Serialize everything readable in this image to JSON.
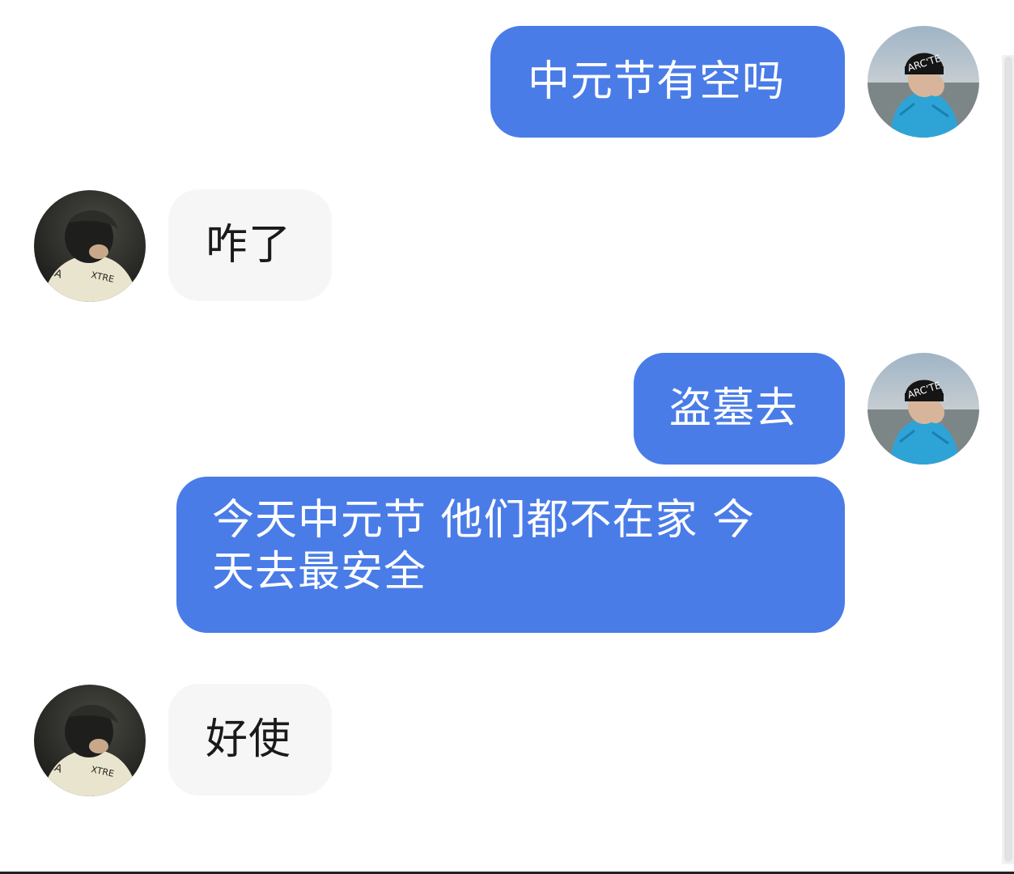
{
  "conversation": {
    "messages": [
      {
        "sender": "me",
        "text": "中元节有空吗"
      },
      {
        "sender": "contact",
        "text": "咋了"
      },
      {
        "sender": "me",
        "text": "盗墓去"
      },
      {
        "sender": "me",
        "text_line1": "今天中元节 他们都不在家 今",
        "text_line2": "天去最安全"
      },
      {
        "sender": "contact",
        "text": "好使"
      }
    ]
  },
  "avatars": {
    "me_hat_text": "ARC'TE",
    "contact_shirt_text_left": "MA",
    "contact_shirt_text_right": "XTRE"
  },
  "colors": {
    "outgoing_bubble": "#4a7ce8",
    "incoming_bubble": "#f6f6f6",
    "outgoing_text": "#ffffff",
    "incoming_text": "#1a1a1a"
  }
}
